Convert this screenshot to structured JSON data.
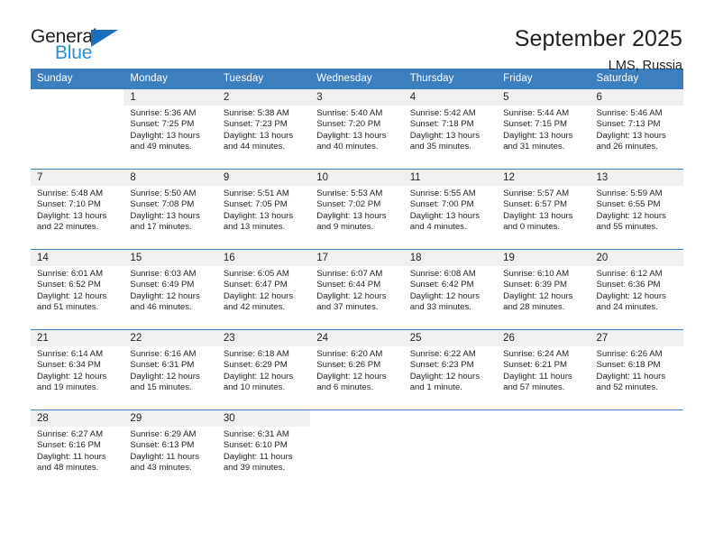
{
  "logo": {
    "word_one": "General",
    "word_two": "Blue",
    "triangle_icon": "blue-triangle-icon",
    "triangle_color": "#1c6fba",
    "blue_text_color": "#2b8fd4"
  },
  "header": {
    "title": "September 2025",
    "subtitle": "LMS, Russia"
  },
  "theme": {
    "header_bg": "#3c7fbf",
    "daynum_bg": "#f0f0f0",
    "cell_bg": "#ffffff",
    "text": "#231f20"
  },
  "calendar": {
    "weekday_headers": [
      "Sunday",
      "Monday",
      "Tuesday",
      "Wednesday",
      "Thursday",
      "Friday",
      "Saturday"
    ],
    "weeks": [
      [
        {
          "day": "",
          "empty": true
        },
        {
          "day": "1",
          "sunrise": "Sunrise: 5:36 AM",
          "sunset": "Sunset: 7:25 PM",
          "daylight": "Daylight: 13 hours and 49 minutes."
        },
        {
          "day": "2",
          "sunrise": "Sunrise: 5:38 AM",
          "sunset": "Sunset: 7:23 PM",
          "daylight": "Daylight: 13 hours and 44 minutes."
        },
        {
          "day": "3",
          "sunrise": "Sunrise: 5:40 AM",
          "sunset": "Sunset: 7:20 PM",
          "daylight": "Daylight: 13 hours and 40 minutes."
        },
        {
          "day": "4",
          "sunrise": "Sunrise: 5:42 AM",
          "sunset": "Sunset: 7:18 PM",
          "daylight": "Daylight: 13 hours and 35 minutes."
        },
        {
          "day": "5",
          "sunrise": "Sunrise: 5:44 AM",
          "sunset": "Sunset: 7:15 PM",
          "daylight": "Daylight: 13 hours and 31 minutes."
        },
        {
          "day": "6",
          "sunrise": "Sunrise: 5:46 AM",
          "sunset": "Sunset: 7:13 PM",
          "daylight": "Daylight: 13 hours and 26 minutes."
        }
      ],
      [
        {
          "day": "7",
          "sunrise": "Sunrise: 5:48 AM",
          "sunset": "Sunset: 7:10 PM",
          "daylight": "Daylight: 13 hours and 22 minutes."
        },
        {
          "day": "8",
          "sunrise": "Sunrise: 5:50 AM",
          "sunset": "Sunset: 7:08 PM",
          "daylight": "Daylight: 13 hours and 17 minutes."
        },
        {
          "day": "9",
          "sunrise": "Sunrise: 5:51 AM",
          "sunset": "Sunset: 7:05 PM",
          "daylight": "Daylight: 13 hours and 13 minutes."
        },
        {
          "day": "10",
          "sunrise": "Sunrise: 5:53 AM",
          "sunset": "Sunset: 7:02 PM",
          "daylight": "Daylight: 13 hours and 9 minutes."
        },
        {
          "day": "11",
          "sunrise": "Sunrise: 5:55 AM",
          "sunset": "Sunset: 7:00 PM",
          "daylight": "Daylight: 13 hours and 4 minutes."
        },
        {
          "day": "12",
          "sunrise": "Sunrise: 5:57 AM",
          "sunset": "Sunset: 6:57 PM",
          "daylight": "Daylight: 13 hours and 0 minutes."
        },
        {
          "day": "13",
          "sunrise": "Sunrise: 5:59 AM",
          "sunset": "Sunset: 6:55 PM",
          "daylight": "Daylight: 12 hours and 55 minutes."
        }
      ],
      [
        {
          "day": "14",
          "sunrise": "Sunrise: 6:01 AM",
          "sunset": "Sunset: 6:52 PM",
          "daylight": "Daylight: 12 hours and 51 minutes."
        },
        {
          "day": "15",
          "sunrise": "Sunrise: 6:03 AM",
          "sunset": "Sunset: 6:49 PM",
          "daylight": "Daylight: 12 hours and 46 minutes."
        },
        {
          "day": "16",
          "sunrise": "Sunrise: 6:05 AM",
          "sunset": "Sunset: 6:47 PM",
          "daylight": "Daylight: 12 hours and 42 minutes."
        },
        {
          "day": "17",
          "sunrise": "Sunrise: 6:07 AM",
          "sunset": "Sunset: 6:44 PM",
          "daylight": "Daylight: 12 hours and 37 minutes."
        },
        {
          "day": "18",
          "sunrise": "Sunrise: 6:08 AM",
          "sunset": "Sunset: 6:42 PM",
          "daylight": "Daylight: 12 hours and 33 minutes."
        },
        {
          "day": "19",
          "sunrise": "Sunrise: 6:10 AM",
          "sunset": "Sunset: 6:39 PM",
          "daylight": "Daylight: 12 hours and 28 minutes."
        },
        {
          "day": "20",
          "sunrise": "Sunrise: 6:12 AM",
          "sunset": "Sunset: 6:36 PM",
          "daylight": "Daylight: 12 hours and 24 minutes."
        }
      ],
      [
        {
          "day": "21",
          "sunrise": "Sunrise: 6:14 AM",
          "sunset": "Sunset: 6:34 PM",
          "daylight": "Daylight: 12 hours and 19 minutes."
        },
        {
          "day": "22",
          "sunrise": "Sunrise: 6:16 AM",
          "sunset": "Sunset: 6:31 PM",
          "daylight": "Daylight: 12 hours and 15 minutes."
        },
        {
          "day": "23",
          "sunrise": "Sunrise: 6:18 AM",
          "sunset": "Sunset: 6:29 PM",
          "daylight": "Daylight: 12 hours and 10 minutes."
        },
        {
          "day": "24",
          "sunrise": "Sunrise: 6:20 AM",
          "sunset": "Sunset: 6:26 PM",
          "daylight": "Daylight: 12 hours and 6 minutes."
        },
        {
          "day": "25",
          "sunrise": "Sunrise: 6:22 AM",
          "sunset": "Sunset: 6:23 PM",
          "daylight": "Daylight: 12 hours and 1 minute."
        },
        {
          "day": "26",
          "sunrise": "Sunrise: 6:24 AM",
          "sunset": "Sunset: 6:21 PM",
          "daylight": "Daylight: 11 hours and 57 minutes."
        },
        {
          "day": "27",
          "sunrise": "Sunrise: 6:26 AM",
          "sunset": "Sunset: 6:18 PM",
          "daylight": "Daylight: 11 hours and 52 minutes."
        }
      ],
      [
        {
          "day": "28",
          "sunrise": "Sunrise: 6:27 AM",
          "sunset": "Sunset: 6:16 PM",
          "daylight": "Daylight: 11 hours and 48 minutes."
        },
        {
          "day": "29",
          "sunrise": "Sunrise: 6:29 AM",
          "sunset": "Sunset: 6:13 PM",
          "daylight": "Daylight: 11 hours and 43 minutes."
        },
        {
          "day": "30",
          "sunrise": "Sunrise: 6:31 AM",
          "sunset": "Sunset: 6:10 PM",
          "daylight": "Daylight: 11 hours and 39 minutes."
        },
        {
          "day": "",
          "empty": true
        },
        {
          "day": "",
          "empty": true
        },
        {
          "day": "",
          "empty": true
        },
        {
          "day": "",
          "empty": true
        }
      ]
    ]
  }
}
